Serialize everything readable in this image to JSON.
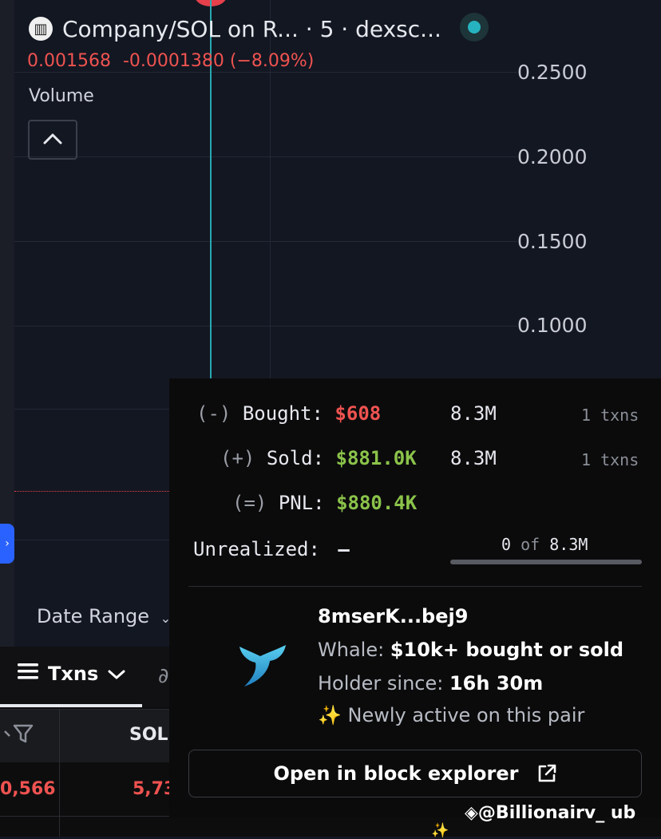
{
  "header": {
    "title": "Company/SOL on R... · 5 · dexsc...",
    "price": "0.001568",
    "change": "-0.0001380 (−8.09%)"
  },
  "chart": {
    "volume_label": "Volume",
    "y_axis": [
      "0.2500",
      "0.2000",
      "0.1500",
      "0.1000"
    ],
    "date_range_label": "Date Range"
  },
  "bottom": {
    "tab_label": "Txns",
    "col_sol": "SOL",
    "cell_left": "0,566",
    "cell_right": "5,73"
  },
  "popup": {
    "bought": {
      "op": "(-)",
      "label": "Bought:",
      "value": "$608",
      "amount": "8.3M",
      "txns": "1 txns"
    },
    "sold": {
      "op": "(+)",
      "label": "Sold:",
      "value": "$881.0K",
      "amount": "8.3M",
      "txns": "1 txns"
    },
    "pnl": {
      "op": "(=)",
      "label": "PNL:",
      "value": "$880.4K"
    },
    "unrealized": {
      "label": "Unrealized:",
      "value": "–"
    },
    "progress": {
      "current": "0",
      "of": "of",
      "total": "8.3M",
      "fraction": 0
    },
    "wallet": {
      "name": "8mserK...bej9",
      "whale_prefix": "Whale:",
      "whale_text": "$10k+ bought or sold",
      "holder_prefix": "Holder since:",
      "holder_value": "16h 30m",
      "active_text": "✨ Newly active on this pair"
    },
    "explorer_button": "Open in block explorer"
  },
  "watermark": "◈@Billionairv_  ub",
  "colors": {
    "red": "#ef5350",
    "green": "#8bc34a",
    "accent_teal": "#2aa8b0",
    "toggle_blue": "#2962ff"
  }
}
